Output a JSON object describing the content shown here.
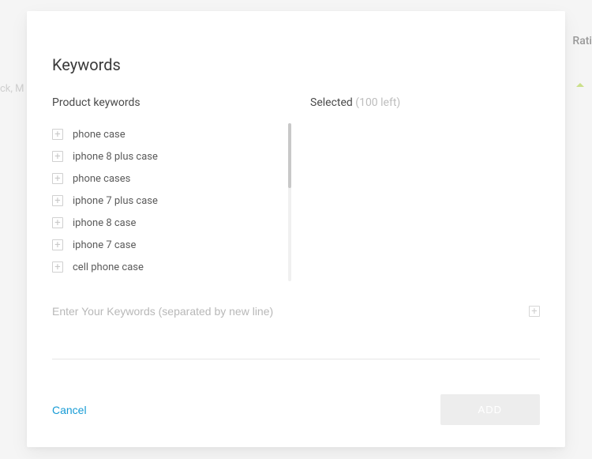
{
  "background": {
    "left_hint": "ck, M",
    "right_label": "Rati"
  },
  "modal": {
    "title": "Keywords",
    "product_header": "Product keywords",
    "selected_header": "Selected",
    "remaining_text": "(100 left)",
    "keywords": [
      "phone case",
      "iphone 8 plus case",
      "phone cases",
      "iphone 7 plus case",
      "iphone 8 case",
      "iphone 7 case",
      "cell phone case"
    ],
    "input_placeholder": "Enter Your Keywords (separated by new line)",
    "cancel_label": "Cancel",
    "add_label": "ADD"
  }
}
